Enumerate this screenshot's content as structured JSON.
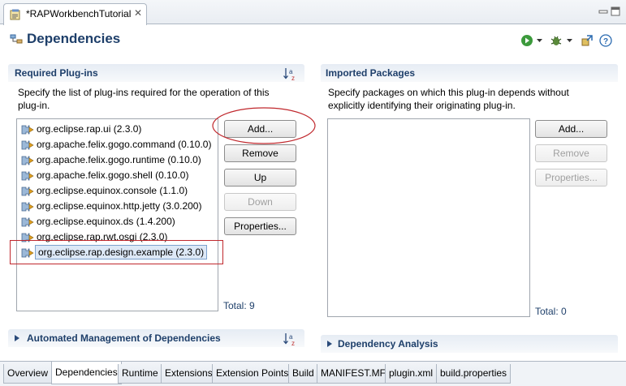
{
  "editor_tab": {
    "title": "*RAPWorkbenchTutorial"
  },
  "page": {
    "title": "Dependencies"
  },
  "required": {
    "title": "Required Plug-ins",
    "desc_line1": "Specify the list of plug-ins required for the operation of this",
    "desc_line2": "plug-in.",
    "items": [
      "org.eclipse.rap.ui (2.3.0)",
      "org.apache.felix.gogo.command (0.10.0)",
      "org.apache.felix.gogo.runtime (0.10.0)",
      "org.apache.felix.gogo.shell (0.10.0)",
      "org.eclipse.equinox.console (1.1.0)",
      "org.eclipse.equinox.http.jetty (3.0.200)",
      "org.eclipse.equinox.ds (1.4.200)",
      "org.eclipse.rap.rwt.osgi (2.3.0)",
      "org.eclipse.rap.design.example (2.3.0)"
    ],
    "buttons": {
      "add": "Add...",
      "remove": "Remove",
      "up": "Up",
      "down": "Down",
      "properties": "Properties..."
    },
    "total": "Total: 9"
  },
  "imported": {
    "title": "Imported Packages",
    "desc_line1": "Specify packages on which this plug-in depends without",
    "desc_line2": "explicitly identifying their originating plug-in.",
    "buttons": {
      "add": "Add...",
      "remove": "Remove",
      "properties": "Properties..."
    },
    "total": "Total: 0"
  },
  "automated": {
    "title": "Automated Management of Dependencies"
  },
  "analysis": {
    "title": "Dependency Analysis"
  },
  "bottom_tabs": [
    "Overview",
    "Dependencies",
    "Runtime",
    "Extensions",
    "Extension Points",
    "Build",
    "MANIFEST.MF",
    "plugin.xml",
    "build.properties"
  ],
  "colors": {
    "section_title": "#1e3f6a",
    "annotation": "#c0282d",
    "selection": "#dde8f6"
  }
}
